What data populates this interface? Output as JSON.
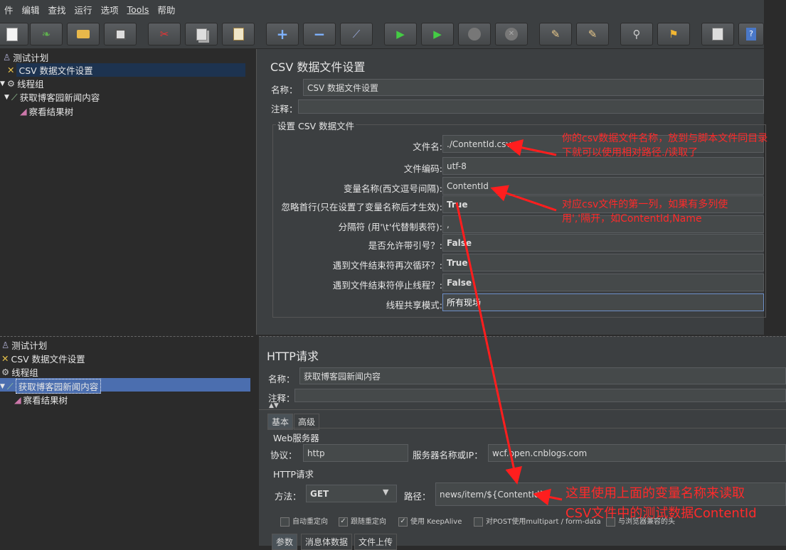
{
  "menu": [
    "件",
    "编辑",
    "查找",
    "运行",
    "选项",
    "Tools",
    "帮助"
  ],
  "toolbar_icons": [
    "new-icon",
    "open-icon",
    "print-icon",
    "save-icon",
    "cut-icon",
    "copy-icon",
    "paste-icon",
    "expand-icon",
    "collapse-icon",
    "toggle-icon",
    "start-icon",
    "start-no-pause-icon",
    "stop-icon",
    "shutdown-icon",
    "clear-icon",
    "clear-all-icon",
    "search-icon",
    "broom-icon",
    "function-list-icon",
    "help-icon"
  ],
  "tree1": {
    "items": [
      "测试计划",
      "CSV 数据文件设置",
      "线程组",
      "获取博客园新闻内容",
      "察看结果树"
    ]
  },
  "csv": {
    "title": "CSV 数据文件设置",
    "name_label": "名称：",
    "name_value": "CSV 数据文件设置",
    "comment_label": "注释：",
    "group_title": "设置 CSV 数据文件",
    "rows": [
      {
        "label": "文件名:",
        "value": "./ContentId.csv"
      },
      {
        "label": "文件编码:",
        "value": "utf-8"
      },
      {
        "label": "变量名称(西文逗号间隔):",
        "value": "ContentId"
      },
      {
        "label": "忽略首行(只在设置了变量名称后才生效):",
        "value": "True"
      },
      {
        "label": "分隔符 (用'\\t'代替制表符):",
        "value": ","
      },
      {
        "label": "是否允许带引号？:",
        "value": "False"
      },
      {
        "label": "遇到文件结束符再次循环？:",
        "value": "True"
      },
      {
        "label": "遇到文件结束符停止线程？:",
        "value": "False"
      },
      {
        "label": "线程共享模式:",
        "value": "所有现场"
      }
    ]
  },
  "annotations": {
    "a1": "你的csv数据文件名称，放到与脚本文件同目录下就可以使用相对路径./读取了",
    "a2": "对应csv文件的第一列，如果有多列使用','隔开，如ContentId,Name",
    "a3_line1": "这里使用上面的变量名称来读取",
    "a3_line2": "CSV文件中的测试数据ContentId"
  },
  "tree2": {
    "items": [
      "测试计划",
      "CSV 数据文件设置",
      "线程组",
      "获取博客园新闻内容",
      "察看结果树"
    ]
  },
  "http": {
    "title": "HTTP请求",
    "name_label": "名称：",
    "name_value": "获取博客园新闻内容",
    "comment_label": "注释：",
    "tabs": [
      "基本",
      "高级"
    ],
    "web_server_title": "Web服务器",
    "protocol_label": "协议：",
    "protocol_value": "http",
    "server_label": "服务器名称或IP：",
    "server_value": "wcf.open.cnblogs.com",
    "http_group_title": "HTTP请求",
    "method_label": "方法：",
    "method_value": "GET",
    "path_label": "路径：",
    "path_value": "news/item/${ContentId}",
    "options": [
      "自动重定向",
      "跟随重定向",
      "使用 KeepAlive",
      "对POST使用multipart / form-data",
      "与浏览器兼容的头"
    ],
    "bottom_tabs": [
      "参数",
      "消息体数据",
      "文件上传"
    ]
  }
}
